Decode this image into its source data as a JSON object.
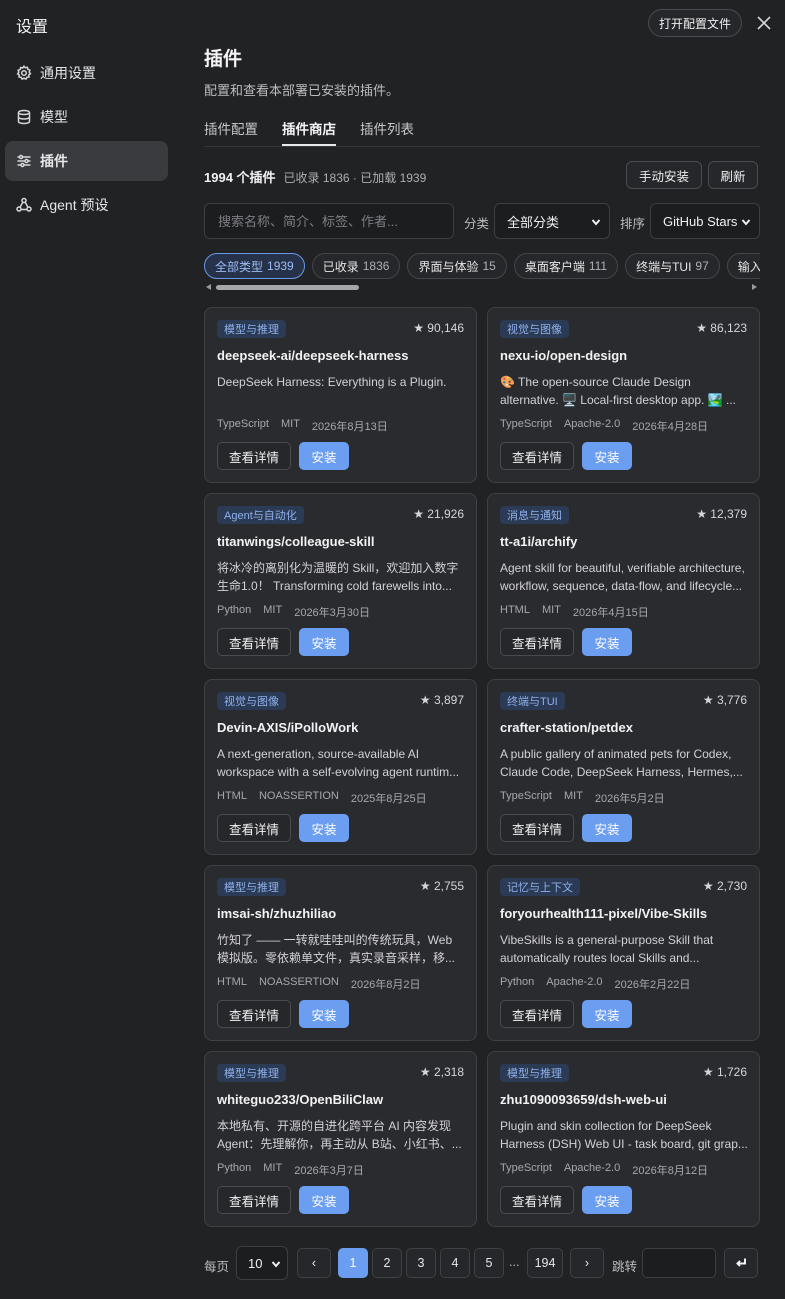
{
  "sidebar": {
    "title": "设置",
    "items": [
      {
        "label": "通用设置",
        "icon": "gear-icon"
      },
      {
        "label": "模型",
        "icon": "database-icon"
      },
      {
        "label": "插件",
        "icon": "sliders-icon"
      },
      {
        "label": "Agent 预设",
        "icon": "agent-icon"
      }
    ],
    "active_index": 2
  },
  "header": {
    "open_config_label": "打开配置文件",
    "close_icon": "close-icon"
  },
  "main": {
    "title": "插件",
    "description": "配置和查看本部署已安装的插件。",
    "tabs": [
      {
        "label": "插件配置"
      },
      {
        "label": "插件商店"
      },
      {
        "label": "插件列表"
      }
    ],
    "active_tab": 1,
    "count_main": "1994 个插件",
    "count_sub": "已收录 1836 · 已加载 1939",
    "manual_install_label": "手动安装",
    "refresh_label": "刷新",
    "search_placeholder": "搜索名称、简介、标签、作者...",
    "category_label": "分类",
    "category_value": "全部分类",
    "sort_label": "排序",
    "sort_value": "GitHub Stars",
    "chips": [
      {
        "label": "全部类型",
        "count": "1939"
      },
      {
        "label": "已收录",
        "count": "1836"
      },
      {
        "label": "界面与体验",
        "count": "15"
      },
      {
        "label": "桌面客户端",
        "count": "111"
      },
      {
        "label": "终端与TUI",
        "count": "97"
      },
      {
        "label": "输入与",
        "count": ""
      }
    ],
    "active_chip": 0
  },
  "card_actions": {
    "detail_label": "查看详情",
    "install_label": "安装"
  },
  "plugins": [
    {
      "tag": "模型与推理",
      "stars": "★ 90,146",
      "repo": "deepseek-ai/deepseek-harness",
      "desc": "DeepSeek Harness: Everything is a Plugin.",
      "lang": "TypeScript",
      "license": "MIT",
      "date": "2026年8月13日"
    },
    {
      "tag": "视觉与图像",
      "stars": "★ 86,123",
      "repo": "nexu-io/open-design",
      "desc": "🎨 The open-source Claude Design alternative. 🖥️ Local-first desktop app. 🏞️ ...",
      "lang": "TypeScript",
      "license": "Apache-2.0",
      "date": "2026年4月28日"
    },
    {
      "tag": "Agent与自动化",
      "stars": "★ 21,926",
      "repo": "titanwings/colleague-skill",
      "desc": "将冰冷的离别化为温暖的 Skill，欢迎加入数字生命1.0！ Transforming cold farewells into...",
      "lang": "Python",
      "license": "MIT",
      "date": "2026年3月30日"
    },
    {
      "tag": "消息与通知",
      "stars": "★ 12,379",
      "repo": "tt-a1i/archify",
      "desc": "Agent skill for beautiful, verifiable architecture, workflow, sequence, data-flow, and lifecycle...",
      "lang": "HTML",
      "license": "MIT",
      "date": "2026年4月15日"
    },
    {
      "tag": "视觉与图像",
      "stars": "★ 3,897",
      "repo": "Devin-AXIS/iPolloWork",
      "desc": "A next-generation, source-available AI workspace with a self-evolving agent runtim...",
      "lang": "HTML",
      "license": "NOASSERTION",
      "date": "2025年8月25日"
    },
    {
      "tag": "终端与TUI",
      "stars": "★ 3,776",
      "repo": "crafter-station/petdex",
      "desc": "A public gallery of animated pets for Codex, Claude Code, DeepSeek Harness, Hermes,...",
      "lang": "TypeScript",
      "license": "MIT",
      "date": "2026年5月2日"
    },
    {
      "tag": "模型与推理",
      "stars": "★ 2,755",
      "repo": "imsai-sh/zhuzhiliao",
      "desc": "竹知了 —— 一转就哇哇叫的传统玩具，Web 模拟版。零依赖单文件，真实录音采样，移...",
      "lang": "HTML",
      "license": "NOASSERTION",
      "date": "2026年8月2日"
    },
    {
      "tag": "记忆与上下文",
      "stars": "★ 2,730",
      "repo": "foryourhealth111-pixel/Vibe-Skills",
      "desc": "VibeSkills is a general-purpose Skill that automatically routes local Skills and...",
      "lang": "Python",
      "license": "Apache-2.0",
      "date": "2026年2月22日"
    },
    {
      "tag": "模型与推理",
      "stars": "★ 2,318",
      "repo": "whiteguo233/OpenBiliClaw",
      "desc": "本地私有、开源的自进化跨平台 AI 内容发现 Agent：先理解你，再主动从 B站、小红书、...",
      "lang": "Python",
      "license": "MIT",
      "date": "2026年3月7日"
    },
    {
      "tag": "模型与推理",
      "stars": "★ 1,726",
      "repo": "zhu1090093659/dsh-web-ui",
      "desc": "Plugin and skin collection for DeepSeek Harness (DSH) Web UI - task board, git grap...",
      "lang": "TypeScript",
      "license": "Apache-2.0",
      "date": "2026年8月12日"
    }
  ],
  "pagination": {
    "per_page_label": "每页",
    "per_page_value": "10",
    "prev_label": "‹",
    "next_label": "›",
    "pages": [
      "1",
      "2",
      "3",
      "4",
      "5"
    ],
    "ellipsis": "...",
    "last_page": "194",
    "current_page": "1",
    "jump_label": "跳转"
  }
}
